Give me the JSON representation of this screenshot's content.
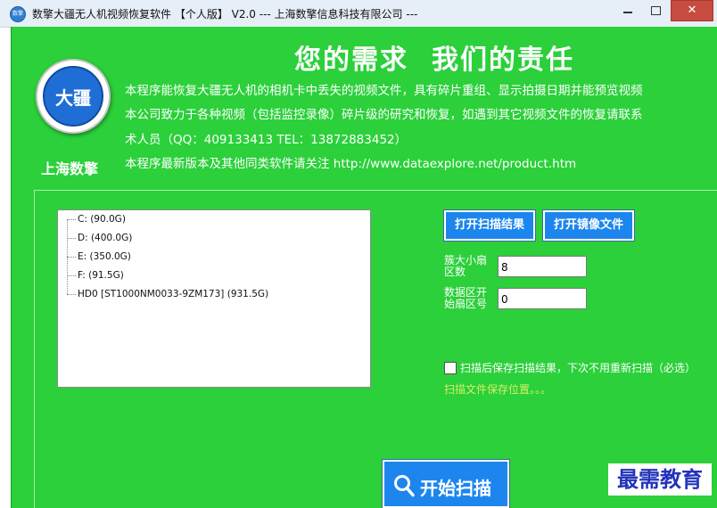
{
  "window": {
    "title": "数擎大疆无人机视频恢复软件  【个人版】 V2.0  --- 上海数擎信息科技有限公司 ---",
    "icon_label": "数擎",
    "close_symbol": "✕"
  },
  "header": {
    "logo_text": "大疆",
    "company_name": "上海数擎",
    "slogan_part1": "您的需求",
    "slogan_part2": "我们的责任",
    "intro_lines": [
      "本程序能恢复大疆无人机的相机卡中丢失的视频文件，具有碎片重组、显示拍摄日期并能预览视频",
      "本公司致力于各种视频（包括监控录像）碎片级的研究和恢复，如遇到其它视频文件的恢复请联系",
      "术人员（QQ：409133413  TEL：13872883452）",
      "本程序最新版本及其他同类软件请关注 http://www.dataexplore.net/product.htm"
    ]
  },
  "drive_tree": {
    "items": [
      {
        "label": "C:    (90.0G)"
      },
      {
        "label": "D:    (400.0G)"
      },
      {
        "label": "E:    (350.0G)"
      },
      {
        "label": "F:    (91.5G)"
      },
      {
        "label": "HD0   [ST1000NM0033-9ZM173] (931.5G)"
      }
    ]
  },
  "buttons": {
    "open_scan_result": "打开扫描结果",
    "open_image_file": "打开镜像文件",
    "start_scan": "开始扫描"
  },
  "fields": {
    "cluster_sectors_label": "簇大小扇区数",
    "cluster_sectors_value": "8",
    "data_start_sector_label": "数据区开始扇区号",
    "data_start_sector_value": "0"
  },
  "options": {
    "save_after_scan_label": "扫描后保存扫描结果，下次不用重新扫描（必选）",
    "save_after_scan_checked": false,
    "save_location_label": "扫描文件保存位置。。。"
  },
  "watermark": {
    "text": "最需教育"
  },
  "colors": {
    "window_bg": "#2bd03a",
    "button_bg": "#1c86ee",
    "save_location_text": "#d6ef6a",
    "watermark_text": "#2233bb"
  }
}
